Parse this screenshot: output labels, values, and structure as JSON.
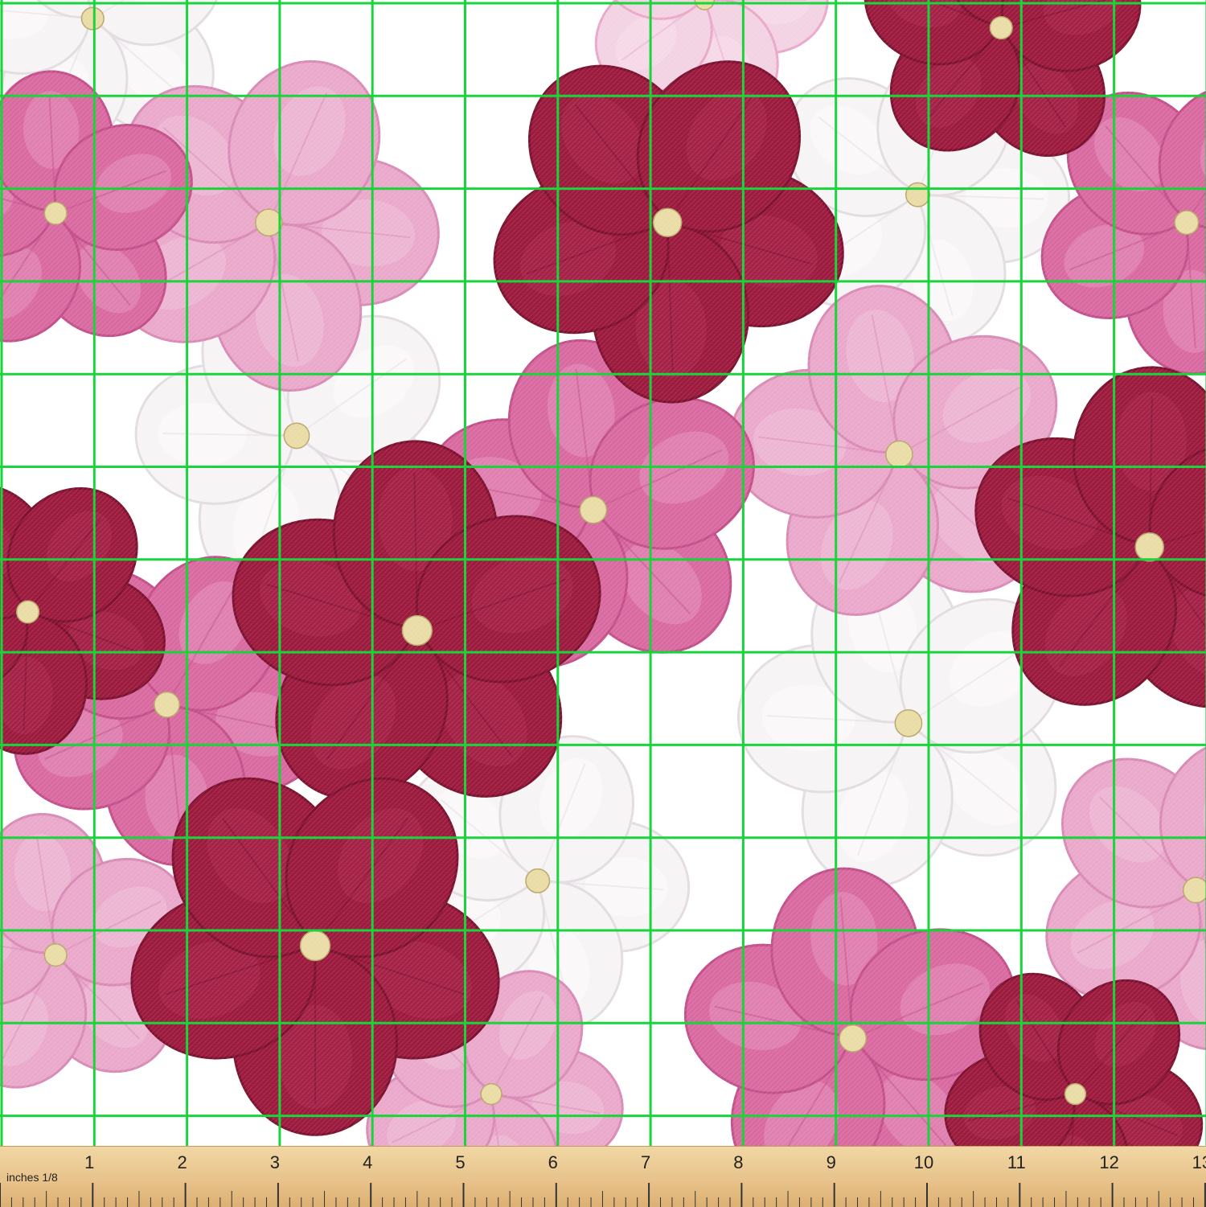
{
  "image": {
    "subject": "floral-fabric-swatch",
    "palette": {
      "background": "#ffffff",
      "burgundy": "#9c1a3e",
      "burgundy_dark": "#7d1230",
      "burgundy_light": "#b83358",
      "pink": "#d96aa1",
      "pink_light": "#eaa8cb",
      "pink_pale": "#f3d2e3",
      "white_petal": "#f7f4f6",
      "white_petal_shade": "#e3dde2",
      "flower_center": "#e9dca6",
      "grid_line": "#19d43a"
    },
    "flowers": [
      {
        "color": "burgundy",
        "cx": 7.2,
        "cy": 2.4,
        "r": 1.9
      },
      {
        "color": "burgundy",
        "cx": 4.5,
        "cy": 6.8,
        "r": 2.0
      },
      {
        "color": "burgundy",
        "cx": 3.4,
        "cy": 10.2,
        "r": 2.0
      },
      {
        "color": "burgundy",
        "cx": 12.4,
        "cy": 5.9,
        "r": 1.9
      },
      {
        "color": "burgundy",
        "cx": 0.3,
        "cy": 6.6,
        "r": 1.5
      },
      {
        "color": "burgundy",
        "cx": 10.8,
        "cy": 0.3,
        "r": 1.5
      },
      {
        "color": "burgundy",
        "cx": 11.6,
        "cy": 11.8,
        "r": 1.4
      },
      {
        "color": "pink",
        "cx": 6.4,
        "cy": 5.5,
        "r": 1.8
      },
      {
        "color": "pink",
        "cx": 1.8,
        "cy": 7.6,
        "r": 1.7
      },
      {
        "color": "pink",
        "cx": 9.2,
        "cy": 11.2,
        "r": 1.8
      },
      {
        "color": "pink",
        "cx": 12.8,
        "cy": 2.4,
        "r": 1.6
      },
      {
        "color": "pink",
        "cx": 0.6,
        "cy": 2.3,
        "r": 1.5
      },
      {
        "color": "pink_light",
        "cx": 2.9,
        "cy": 2.4,
        "r": 1.8
      },
      {
        "color": "pink_light",
        "cx": 9.7,
        "cy": 4.9,
        "r": 1.8
      },
      {
        "color": "pink_light",
        "cx": 12.9,
        "cy": 9.6,
        "r": 1.7
      },
      {
        "color": "pink_light",
        "cx": 0.6,
        "cy": 10.3,
        "r": 1.5
      },
      {
        "color": "pink_light",
        "cx": 5.3,
        "cy": 11.8,
        "r": 1.4
      },
      {
        "color": "white",
        "cx": 3.2,
        "cy": 4.7,
        "r": 1.7
      },
      {
        "color": "white",
        "cx": 9.9,
        "cy": 2.1,
        "r": 1.6
      },
      {
        "color": "white",
        "cx": 9.8,
        "cy": 7.8,
        "r": 1.8
      },
      {
        "color": "white",
        "cx": 5.8,
        "cy": 9.5,
        "r": 1.6
      },
      {
        "color": "white",
        "cx": 1.0,
        "cy": 0.2,
        "r": 1.5
      },
      {
        "color": "pink_pale",
        "cx": 7.6,
        "cy": 0.0,
        "r": 1.3
      }
    ],
    "grid": {
      "columns": 13,
      "rows": 13
    }
  },
  "ruler": {
    "caption": "inches 1/8",
    "numbers": [
      "1",
      "2",
      "3",
      "4",
      "5",
      "6",
      "7",
      "8",
      "9",
      "10",
      "11",
      "12",
      "13"
    ],
    "subdivisions_per_inch": 8,
    "color": "#e7c189"
  }
}
